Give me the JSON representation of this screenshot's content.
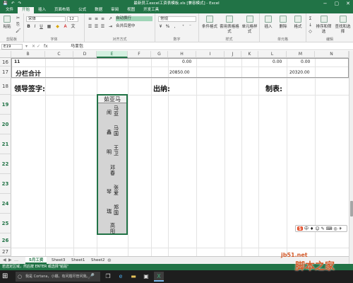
{
  "window": {
    "title": "最新员工excel工资表模板.xls [兼容模式] - Excel",
    "quick_access": [
      "保存",
      "撤销",
      "重做"
    ],
    "controls": [
      "−",
      "▢",
      "✕"
    ]
  },
  "tabs": [
    "文件",
    "开始",
    "插入",
    "页面布局",
    "公式",
    "数据",
    "审阅",
    "视图",
    "开发工具"
  ],
  "active_tab": "开始",
  "ribbon": {
    "clipboard_label": "剪贴板",
    "paste_label": "粘贴",
    "font_name": "宋体",
    "font_size": "12",
    "font_group_label": "字体",
    "bold": "B",
    "italic": "I",
    "underline": "U",
    "align_group_label": "对齐方式",
    "wrap_label": "自动换行",
    "merge_label": "合并后居中",
    "number_format": "常规",
    "number_group_label": "数字",
    "cond_format": "条件格式",
    "table_format": "套用表格格式",
    "cell_styles": "单元格样式",
    "styles_group_label": "样式",
    "insert": "插入",
    "delete": "删除",
    "format": "格式",
    "cells_group_label": "单元格",
    "sort_filter": "排序和筛选",
    "find_select": "查找和选择",
    "edit_group_label": "编辑"
  },
  "formula_bar": {
    "name_box": "E19",
    "fx": "fx",
    "content": "马亚包"
  },
  "columns": [
    "B",
    "C",
    "D",
    "E",
    "F",
    "G",
    "H",
    "I",
    "J",
    "K",
    "L",
    "M",
    "N"
  ],
  "selected_column": "E",
  "rows": [
    "16",
    "17",
    "18",
    "19",
    "20",
    "21",
    "22",
    "23",
    "24",
    "25",
    "26",
    "27"
  ],
  "cells": {
    "r16_a": "11",
    "r16_h": "0.00",
    "r16_l": "0.00",
    "r16_m": "0.00",
    "r17_b": "分栏合计",
    "r17_h": "20850.00",
    "r17_m": "20320.00",
    "leader_sign": "领导签字:",
    "cashier": "出纳:",
    "maker": "制表:"
  },
  "selected_cell": {
    "header": "茹亚马",
    "names": [
      {
        "col1": "马亚",
        "col2": "闹"
      },
      {
        "col1": "马国",
        "col2": "鑫"
      },
      {
        "col1": "王卫",
        "col2": "明"
      },
      {
        "col1": "邓春",
        "col2": ""
      },
      {
        "col1": "张爱",
        "col2": "琴"
      },
      {
        "col1": "郑国",
        "col2": "瑞"
      },
      {
        "col1": "高阳",
        "col2": ""
      }
    ]
  },
  "sheet_tabs": [
    "5月工资",
    "Sheet3",
    "Sheet1",
    "Sheet2"
  ],
  "active_sheet": "5月工资",
  "sheet_nav": [
    "◀",
    "▶",
    "…"
  ],
  "status_text": "若选定区域，然后按 ENTER 或选择\"粘贴\"",
  "taskbar": {
    "search_placeholder": "我是 Cortana，小娜。有问题尽管问我。",
    "mic": "🎤"
  },
  "ime": {
    "brand": "S",
    "items": [
      "中",
      "♦",
      "☺",
      "✎",
      "⌨",
      "◎",
      "✈"
    ]
  },
  "watermark": {
    "site": "jb51.net",
    "name": "脚本之家"
  }
}
